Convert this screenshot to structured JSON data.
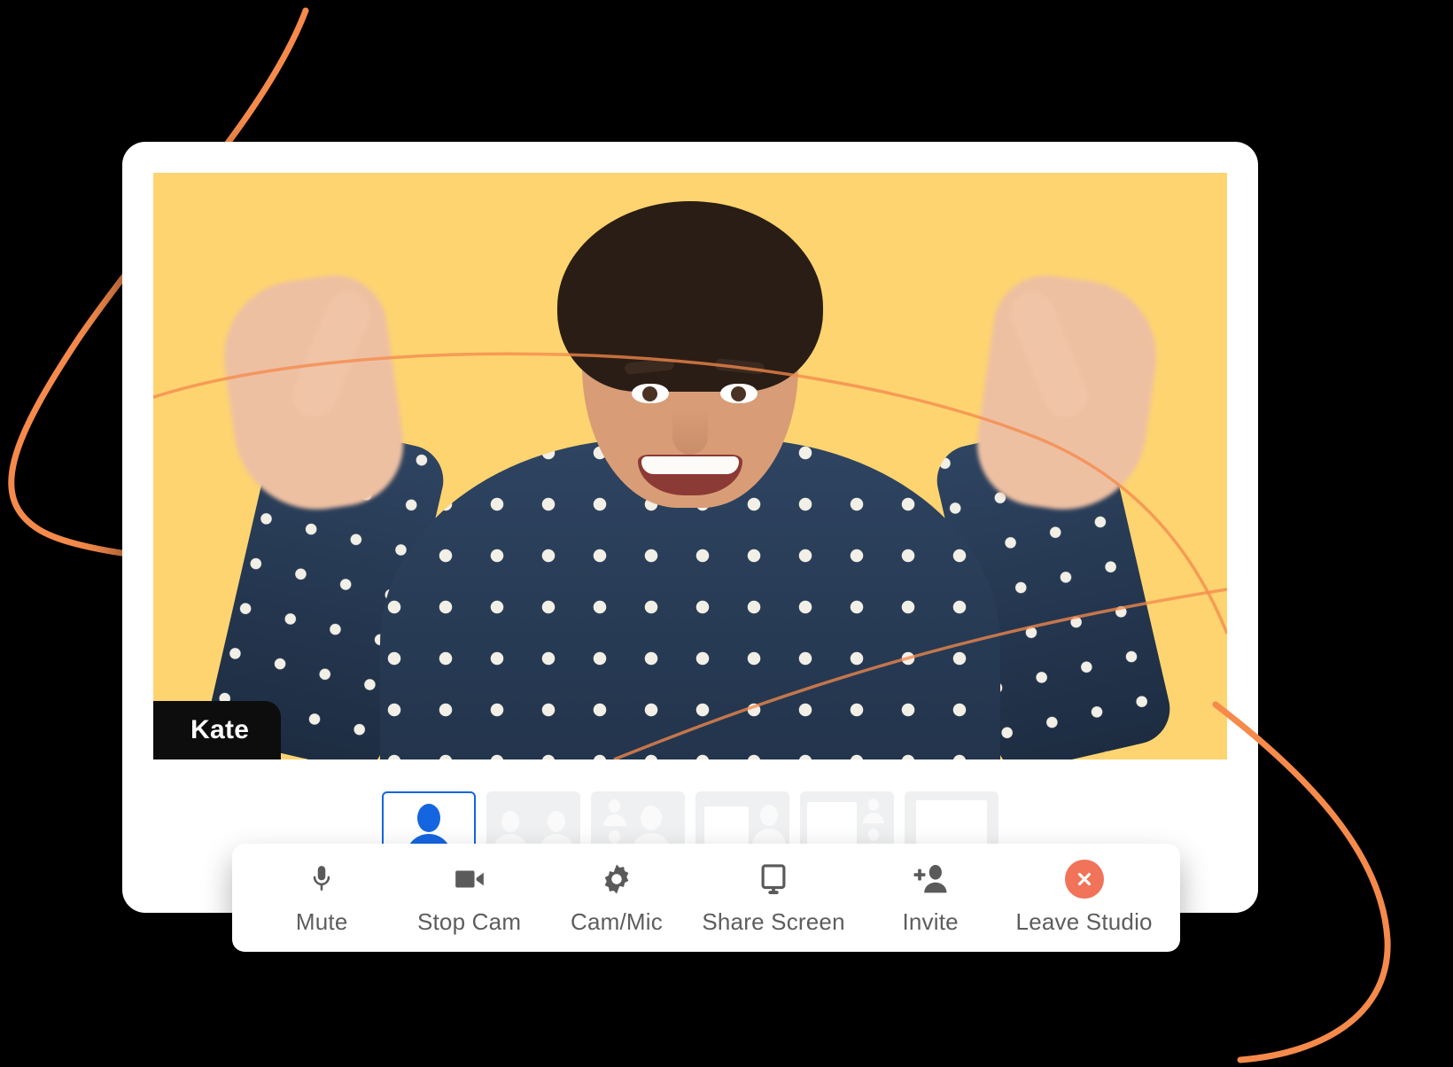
{
  "meta": {
    "app_kind": "video-conferencing-studio",
    "background_color": "#000000",
    "accent_blue": "#1565e0",
    "accent_orange": "#f58a4b",
    "leave_red": "#f0735a",
    "video_bg_yellow": "#fdd470"
  },
  "video": {
    "participant_name": "Kate",
    "badge_bg": "#0d0d0d",
    "badge_text_color": "#ffffff"
  },
  "layout_selector": {
    "options": [
      {
        "id": "speaker-view",
        "icon": "single-person-layout-icon",
        "selected": true
      },
      {
        "id": "two-people-view",
        "icon": "two-people-layout-icon",
        "selected": false
      },
      {
        "id": "three-people-view",
        "icon": "three-people-layout-icon",
        "selected": false
      },
      {
        "id": "screen-plus-one",
        "icon": "screen-and-person-layout-icon",
        "selected": false
      },
      {
        "id": "screen-plus-list",
        "icon": "screen-and-people-list-layout-icon",
        "selected": false
      },
      {
        "id": "screen-only",
        "icon": "screen-only-layout-icon",
        "selected": false
      }
    ]
  },
  "controls": [
    {
      "id": "mute",
      "label": "Mute",
      "icon": "microphone-icon"
    },
    {
      "id": "stop-cam",
      "label": "Stop Cam",
      "icon": "video-camera-icon"
    },
    {
      "id": "cam-mic",
      "label": "Cam/Mic",
      "icon": "gear-icon"
    },
    {
      "id": "share-screen",
      "label": "Share Screen",
      "icon": "monitor-icon"
    },
    {
      "id": "invite",
      "label": "Invite",
      "icon": "add-person-icon"
    },
    {
      "id": "leave-studio",
      "label": "Leave Studio",
      "icon": "close-circle-icon"
    }
  ]
}
